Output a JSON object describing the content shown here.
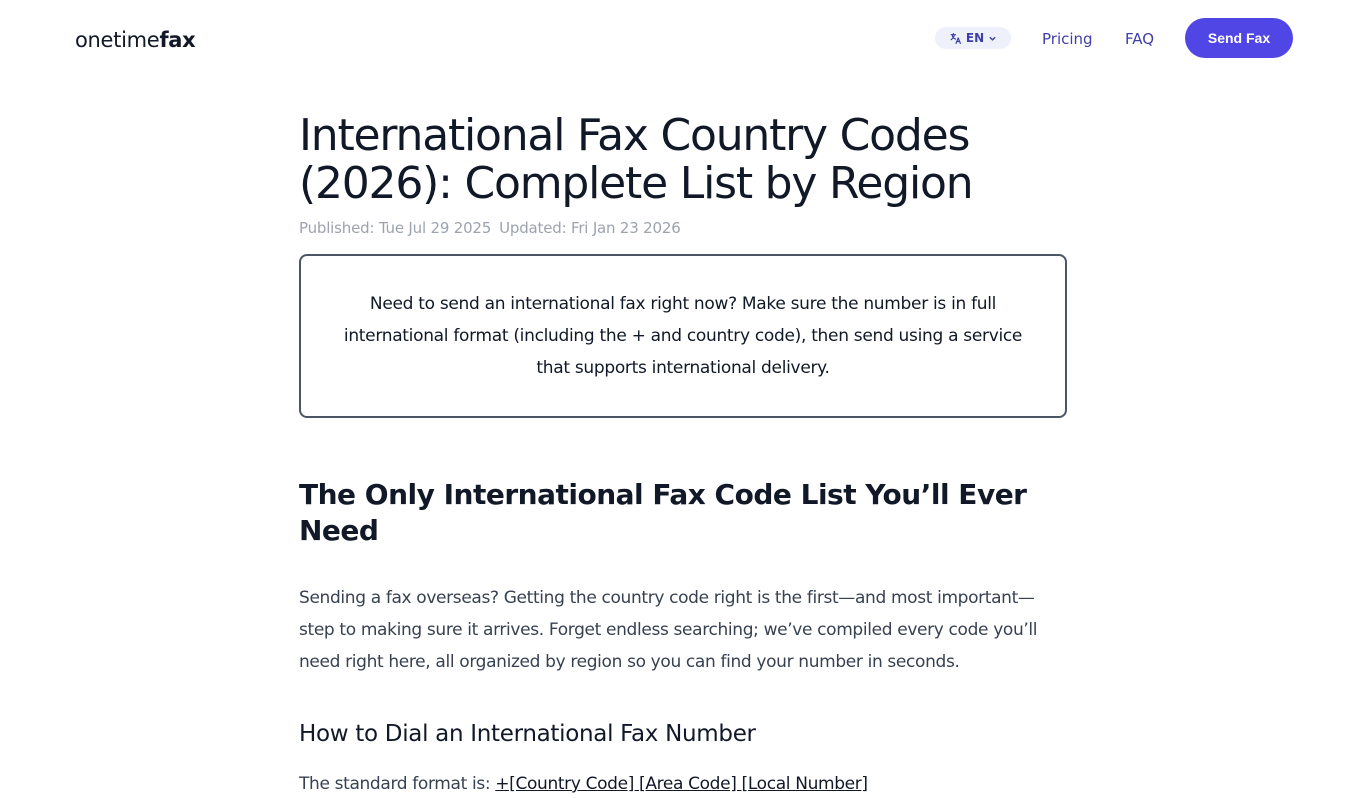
{
  "header": {
    "logo_regular": "onetime",
    "logo_bold": "fax",
    "language": {
      "icon": "translate-icon",
      "label": "EN",
      "chevron": "chevron-down-icon"
    },
    "nav": {
      "pricing": "Pricing",
      "faq": "FAQ"
    },
    "cta_label": "Send Fax"
  },
  "article": {
    "title": "International Fax Country Codes (2026): Complete List by Region",
    "published": "Published: Tue Jul 29 2025",
    "updated": "Updated: Fri Jan 23 2026",
    "callout": "Need to send an international fax right now? Make sure the number is in full international format (including the + and country code), then send using a service that supports international delivery.",
    "section_heading": "The Only International Fax Code List You’ll Ever Need",
    "intro": "Sending a fax overseas? Getting the country code right is the first—and most important—step to making sure it arrives. Forget endless searching; we’ve compiled every code you’ll need right here, all organized by region so you can find your number in seconds.",
    "subheading": "How to Dial an International Fax Number",
    "format_prefix": "The standard format is: ",
    "format_code": "+[Country Code] [Area Code] [Local Number]"
  },
  "colors": {
    "accent": "#4f46e5",
    "nav_link": "#3f3fa8",
    "muted": "#9ca3af",
    "border": "#4b5563"
  }
}
